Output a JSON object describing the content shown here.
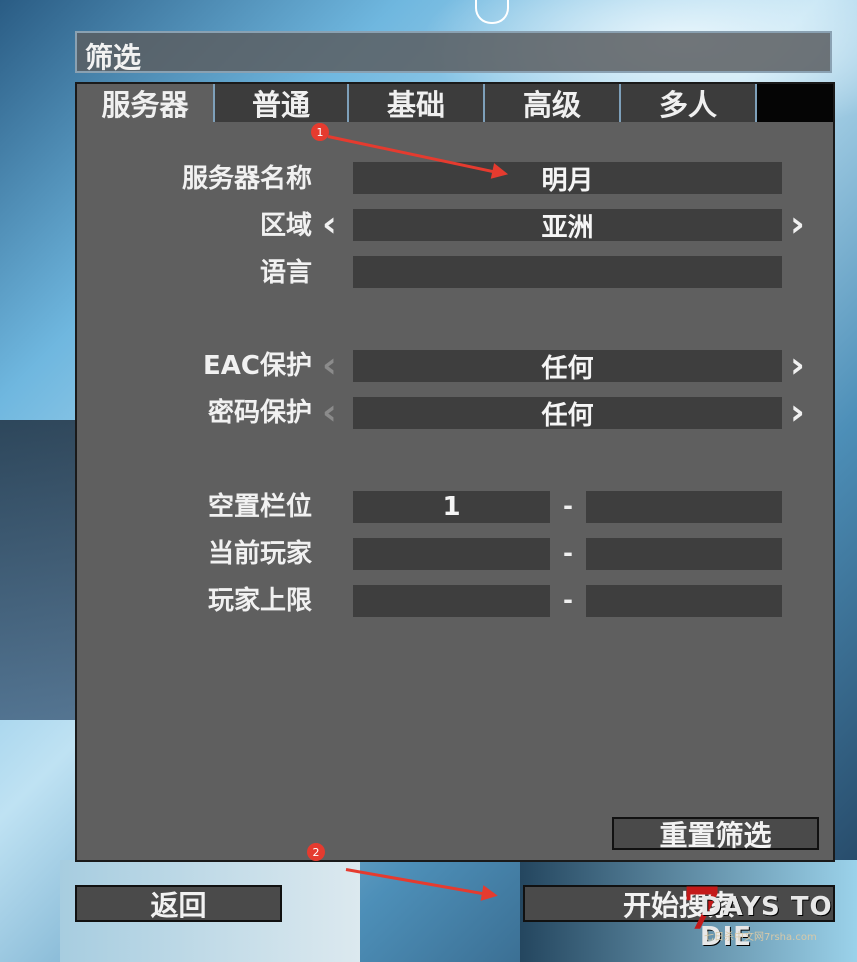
{
  "window": {
    "title": "筛选"
  },
  "tabs": [
    {
      "label": "服务器",
      "active": true
    },
    {
      "label": "普通",
      "active": false
    },
    {
      "label": "基础",
      "active": false
    },
    {
      "label": "高级",
      "active": false
    },
    {
      "label": "多人",
      "active": false
    }
  ],
  "fields": {
    "server_name": {
      "label": "服务器名称",
      "value": "明月"
    },
    "region": {
      "label": "区域",
      "value": "亚洲"
    },
    "language": {
      "label": "语言",
      "value": ""
    },
    "eac": {
      "label": "EAC保护",
      "value": "任何"
    },
    "password": {
      "label": "密码保护",
      "value": "任何"
    },
    "free_slots": {
      "label": "空置栏位",
      "min": "1",
      "max": "",
      "separator": "-"
    },
    "current_players": {
      "label": "当前玩家",
      "min": "",
      "max": "",
      "separator": "-"
    },
    "max_players": {
      "label": "玩家上限",
      "min": "",
      "max": "",
      "separator": "-"
    }
  },
  "buttons": {
    "reset": "重置筛选",
    "back": "返回",
    "start_search": "开始搜索"
  },
  "annotations": {
    "badge1": "1",
    "badge2": "2"
  },
  "logo": {
    "numeral": "7",
    "text": "DAYS TO DIE",
    "subtitle": "七日杀中文网7rsha.com"
  },
  "colors": {
    "panel": "#5f5f5f",
    "field": "#3e3e3e",
    "tab_border": "#7ea0ba",
    "annotation": "#e53b2f"
  }
}
